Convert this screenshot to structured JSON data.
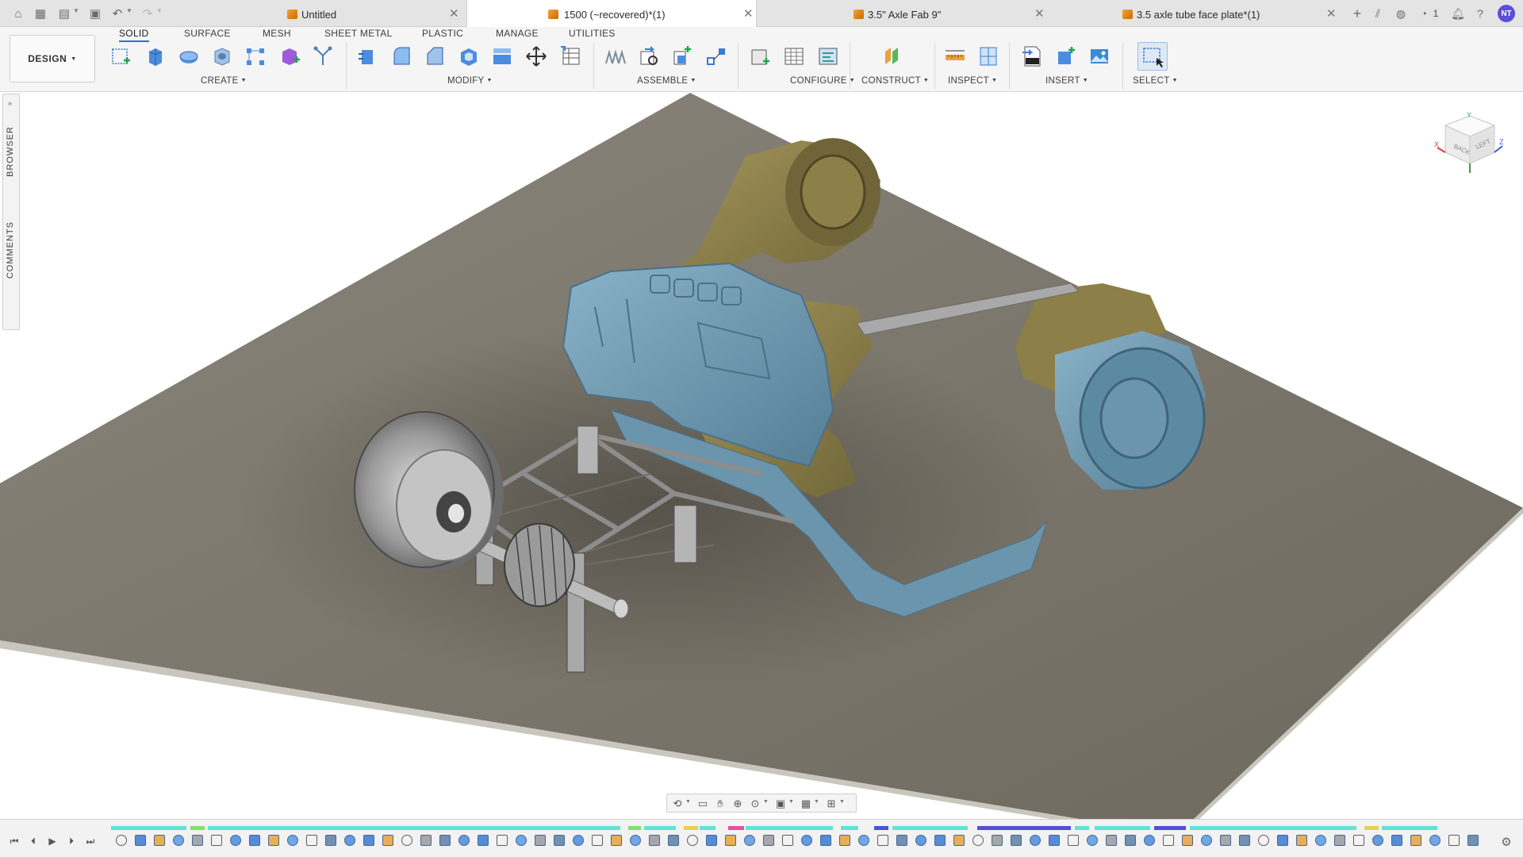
{
  "tabs": [
    {
      "title": "Untitled",
      "active": false
    },
    {
      "title": "1500 (~recovered)*(1)",
      "active": true
    },
    {
      "title": "3.5\" Axle Fab 9\"",
      "active": false
    },
    {
      "title": "3.5 axle tube face plate*(1)",
      "active": false
    }
  ],
  "topbar": {
    "job_count": "1",
    "avatar_initials": "NT"
  },
  "workspace": {
    "design_label": "DESIGN"
  },
  "ribbon_tabs": [
    "SOLID",
    "SURFACE",
    "MESH",
    "SHEET METAL",
    "PLASTIC",
    "MANAGE",
    "UTILITIES"
  ],
  "groups": [
    "CREATE",
    "MODIFY",
    "ASSEMBLE",
    "CONFIGURE",
    "CONSTRUCT",
    "INSPECT",
    "INSERT",
    "SELECT"
  ],
  "side_panel": {
    "browser": "BROWSER",
    "comments": "COMMENTS"
  },
  "viewcube": {
    "faces": [
      "BACK",
      "LEFT"
    ],
    "axes": [
      "X",
      "Y",
      "Z"
    ]
  },
  "colors": {
    "ground": "#7b766b",
    "body_blue": "#6a95ad",
    "body_olive": "#8c7f47",
    "accent": "#2b6fd6",
    "timeline_cyan": "#5fe3d6",
    "timeline_indigo": "#5050d8"
  }
}
